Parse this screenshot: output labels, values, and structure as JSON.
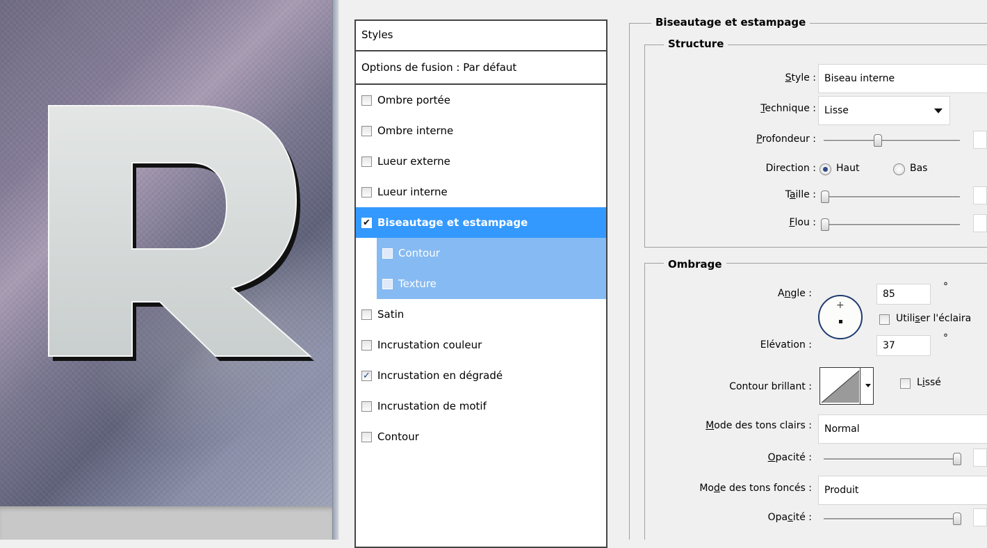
{
  "colors": {
    "selection": "#3399ff",
    "sub_selection": "#86baf2",
    "dialog_bg": "#f0f0f0"
  },
  "canvas": {
    "letter": "R"
  },
  "styles_panel": {
    "header": "Styles",
    "blend_options": "Options de fusion : Par défaut",
    "items": [
      {
        "label": "Ombre portée",
        "checked": false
      },
      {
        "label": "Ombre interne",
        "checked": false
      },
      {
        "label": "Lueur externe",
        "checked": false
      },
      {
        "label": "Lueur interne",
        "checked": false
      },
      {
        "label": "Biseautage et estampage",
        "checked": true
      },
      {
        "label": "Contour",
        "checked": false
      },
      {
        "label": "Texture",
        "checked": false
      },
      {
        "label": "Satin",
        "checked": false
      },
      {
        "label": "Incrustation couleur",
        "checked": false
      },
      {
        "label": "Incrustation en dégradé",
        "checked": true
      },
      {
        "label": "Incrustation de motif",
        "checked": false
      },
      {
        "label": "Contour",
        "checked": false
      }
    ]
  },
  "bevel": {
    "title": "Biseautage et estampage",
    "structure": {
      "title": "Structure",
      "style_label_key": "S",
      "style_label_rest": "tyle :",
      "style_value": "Biseau interne",
      "technique_label_key": "T",
      "technique_label_rest": "echnique :",
      "technique_value": "Lisse",
      "depth_label_key": "P",
      "depth_label_rest": "rofondeur :",
      "depth_level": 0.4,
      "direction_label": "Direction :",
      "direction_up": "Haut",
      "direction_down": "Bas",
      "size_label_a": "T",
      "size_label_key": "a",
      "size_label_rest": "ille :",
      "size_level": 0.0,
      "soften_label_key": "F",
      "soften_label_rest": "lou :",
      "soften_level": 0.0
    },
    "shading": {
      "title": "Ombrage",
      "angle_label_a": "A",
      "angle_label_key": "n",
      "angle_label_rest": "gle :",
      "angle_value": "85",
      "degree_symbol": "°",
      "use_global_a": "Utili",
      "use_global_key": "s",
      "use_global_rest": "er l'éclaira",
      "altitude_label": "Elévation :",
      "altitude_value": "37",
      "gloss_label": "Contour brillant :",
      "antialias_a": "L",
      "antialias_key": "i",
      "antialias_rest": "ssé",
      "highlight_mode_label_key": "M",
      "highlight_mode_label_rest": "ode des tons clairs :",
      "highlight_mode_value": "Normal",
      "highlight_opacity_key": "O",
      "highlight_opacity_rest": "pacité :",
      "highlight_opacity_level": 1.0,
      "shadow_mode_label_a": "Mo",
      "shadow_mode_label_key": "d",
      "shadow_mode_label_rest": "e des tons foncés :",
      "shadow_mode_value": "Produit",
      "shadow_opacity_a": "Opa",
      "shadow_opacity_key": "c",
      "shadow_opacity_rest": "ité :",
      "shadow_opacity_level": 1.0
    }
  }
}
